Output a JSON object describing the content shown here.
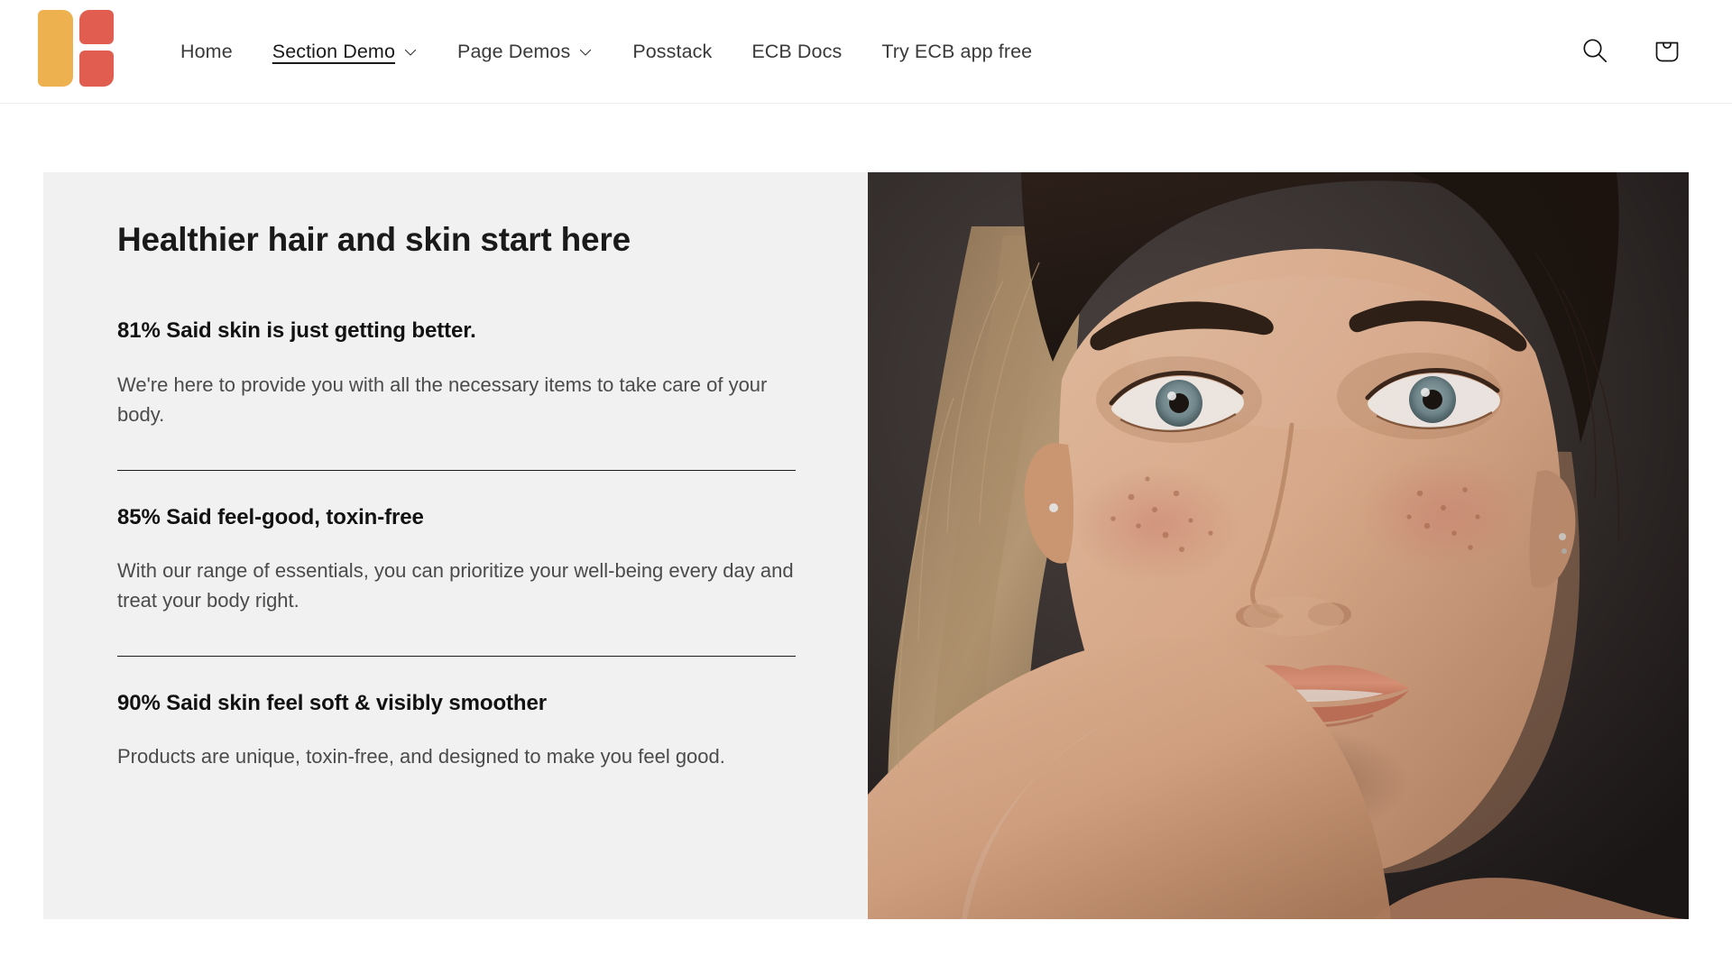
{
  "header": {
    "logo": {
      "name": "site-logo",
      "colors": {
        "red": "#e05d4f",
        "yellow": "#edb24f"
      }
    },
    "nav": [
      {
        "label": "Home",
        "has_dropdown": false,
        "active": false
      },
      {
        "label": "Section Demo",
        "has_dropdown": true,
        "active": true
      },
      {
        "label": "Page Demos",
        "has_dropdown": true,
        "active": false
      },
      {
        "label": "Posstack",
        "has_dropdown": false,
        "active": false
      },
      {
        "label": "ECB Docs",
        "has_dropdown": false,
        "active": false
      },
      {
        "label": "Try ECB app free",
        "has_dropdown": false,
        "active": false
      }
    ],
    "actions": [
      {
        "label": "Search",
        "icon": "search-icon"
      },
      {
        "label": "Cart",
        "icon": "shopping-bag-icon"
      }
    ]
  },
  "section": {
    "title": "Healthier hair and skin start here",
    "background": "#f1f1f1",
    "stats": [
      {
        "heading": "81% Said skin is just getting better.",
        "body": "We're here to provide you with all the necessary items to take care of your body."
      },
      {
        "heading": "85% Said feel-good, toxin-free",
        "body": "With our range of essentials, you can prioritize your well-being every day and treat your body right."
      },
      {
        "heading": "90% Said skin feel soft & visibly smoother",
        "body": "Products are unique, toxin-free, and designed to make you feel good."
      }
    ],
    "image": {
      "alt": "Close-up portrait of a woman with freckles resting her chin on her arm",
      "background_color": "#2b2624"
    }
  }
}
